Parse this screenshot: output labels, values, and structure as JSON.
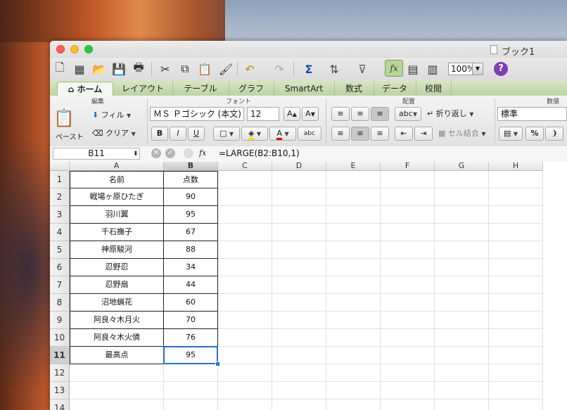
{
  "window": {
    "title": "ブック1"
  },
  "toolbar": {
    "zoom": "100%",
    "help": "?"
  },
  "ribbon_tabs": [
    {
      "label": "ホーム",
      "active": true
    },
    {
      "label": "レイアウト"
    },
    {
      "label": "テーブル"
    },
    {
      "label": "グラフ"
    },
    {
      "label": "SmartArt"
    },
    {
      "label": "数式"
    },
    {
      "label": "データ"
    },
    {
      "label": "校閲"
    }
  ],
  "ribbon": {
    "groups": {
      "edit": "編集",
      "font": "フォント",
      "align": "配置",
      "number": "数値"
    },
    "paste": "ペースト",
    "fill": "フィル",
    "clear": "クリア",
    "font_name": "ＭＳ Ｐゴシック (本文)",
    "font_size": "12",
    "wrap": "折り返し",
    "merge": "セル結合",
    "number_format": "標準",
    "abc": "abc",
    "bold": "B",
    "italic": "I",
    "underline": "U",
    "percent": "%"
  },
  "formula_bar": {
    "name_box": "B11",
    "fx": "fx",
    "formula": "=LARGE(B2:B10,1)"
  },
  "sheet": {
    "columns": [
      "A",
      "B",
      "C",
      "D",
      "E",
      "F",
      "G",
      "H"
    ],
    "rows": [
      "1",
      "2",
      "3",
      "4",
      "5",
      "6",
      "7",
      "8",
      "9",
      "10",
      "11",
      "12",
      "13",
      "14"
    ],
    "selected_cell": "B11",
    "data": [
      [
        "名前",
        "点数"
      ],
      [
        "戦場ヶ原ひたぎ",
        "90"
      ],
      [
        "羽川翼",
        "95"
      ],
      [
        "千石撫子",
        "67"
      ],
      [
        "神原駿河",
        "88"
      ],
      [
        "忍野忍",
        "34"
      ],
      [
        "忍野扇",
        "44"
      ],
      [
        "沼地蝋花",
        "60"
      ],
      [
        "阿良々木月火",
        "70"
      ],
      [
        "阿良々木火憐",
        "76"
      ],
      [
        "最高点",
        "95"
      ]
    ]
  }
}
